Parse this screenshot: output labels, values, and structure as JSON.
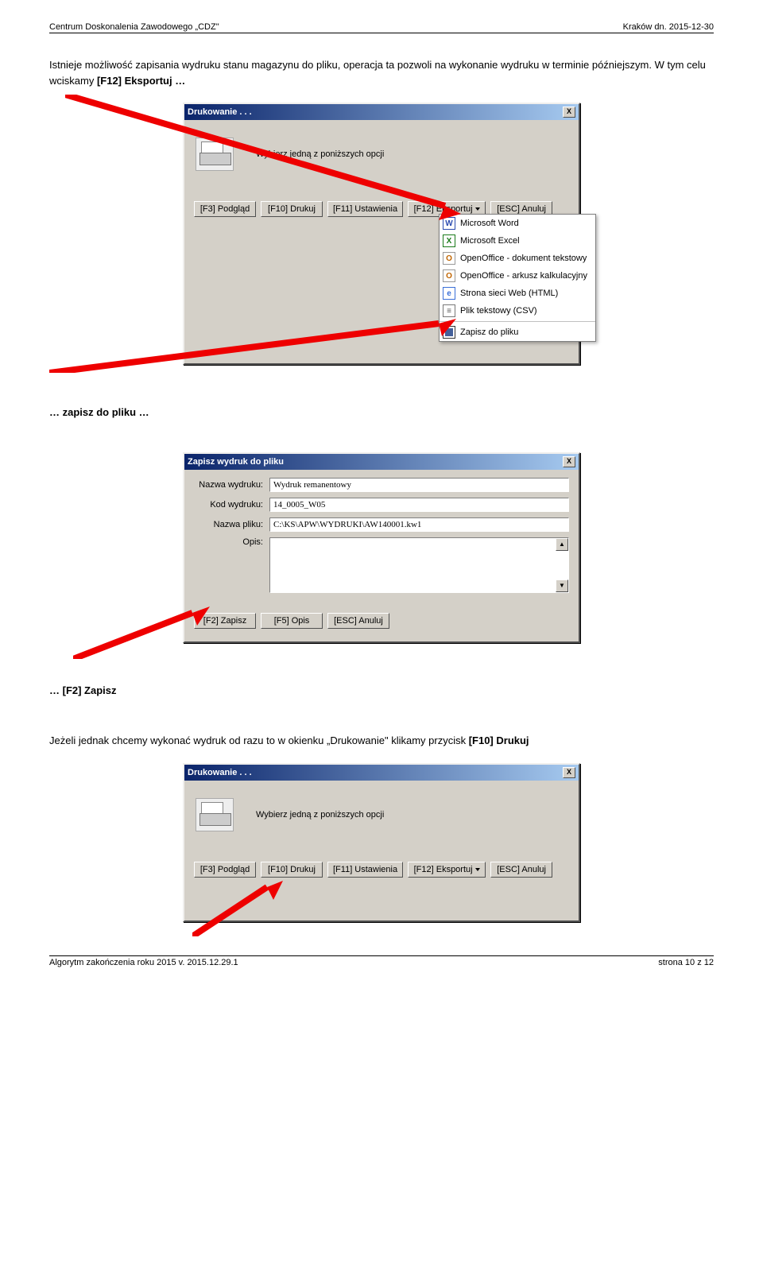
{
  "header": {
    "left": "Centrum Doskonalenia Zawodowego „CDZ\"",
    "right": "Kraków dn. 2015-12-30"
  },
  "para1_pre": "Istnieje możliwość zapisania wydruku stanu magazynu do pliku, operacja ta pozwoli na wykonanie wydruku w terminie późniejszym. W tym celu wciskamy  ",
  "para1_bold": "[F12] Eksportuj …",
  "dlg_print": {
    "title": "Drukowanie . . .",
    "close": "X",
    "prompt": "Wybierz jedną z poniższych opcji",
    "buttons": {
      "f3": "[F3] Podgląd",
      "f10": "[F10] Drukuj",
      "f11": "[F11] Ustawienia",
      "f12": "[F12] Eksportuj",
      "esc": "[ESC] Anuluj"
    }
  },
  "export_menu": {
    "items": [
      {
        "ico": "W",
        "cls": "ico-word",
        "label": "Microsoft Word"
      },
      {
        "ico": "X",
        "cls": "ico-xls",
        "label": "Microsoft Excel"
      },
      {
        "ico": "O",
        "cls": "ico-oo",
        "label": "OpenOffice - dokument tekstowy"
      },
      {
        "ico": "O",
        "cls": "ico-oo",
        "label": "OpenOffice - arkusz kalkulacyjny"
      },
      {
        "ico": "e",
        "cls": "ico-html",
        "label": "Strona sieci Web (HTML)"
      },
      {
        "ico": "≡",
        "cls": "ico-csv",
        "label": "Plik tekstowy (CSV)"
      }
    ],
    "save": "Zapisz do pliku"
  },
  "label_zapisz": "… zapisz do pliku …",
  "dlg_save": {
    "title": "Zapisz wydruk do pliku",
    "close": "X",
    "fields": {
      "name_l": "Nazwa wydruku:",
      "name_v": "Wydruk remanentowy",
      "code_l": "Kod wydruku:",
      "code_v": "14_0005_W05",
      "file_l": "Nazwa pliku:",
      "file_v": "C:\\KS\\APW\\WYDRUKI\\AW140001.kw1",
      "desc_l": "Opis:"
    },
    "buttons": {
      "f2": "[F2] Zapisz",
      "f5": "[F5] Opis",
      "esc": "[ESC] Anuluj"
    }
  },
  "label_f2": "… [F2] Zapisz",
  "para2_pre": "Jeżeli jednak chcemy wykonać wydruk od razu to w okienku „Drukowanie\" klikamy przycisk ",
  "para2_bold": "[F10] Drukuj",
  "footer": {
    "left": "Algorytm zakończenia roku 2015   v. 2015.12.29.1",
    "right": "strona 10 z 12"
  }
}
